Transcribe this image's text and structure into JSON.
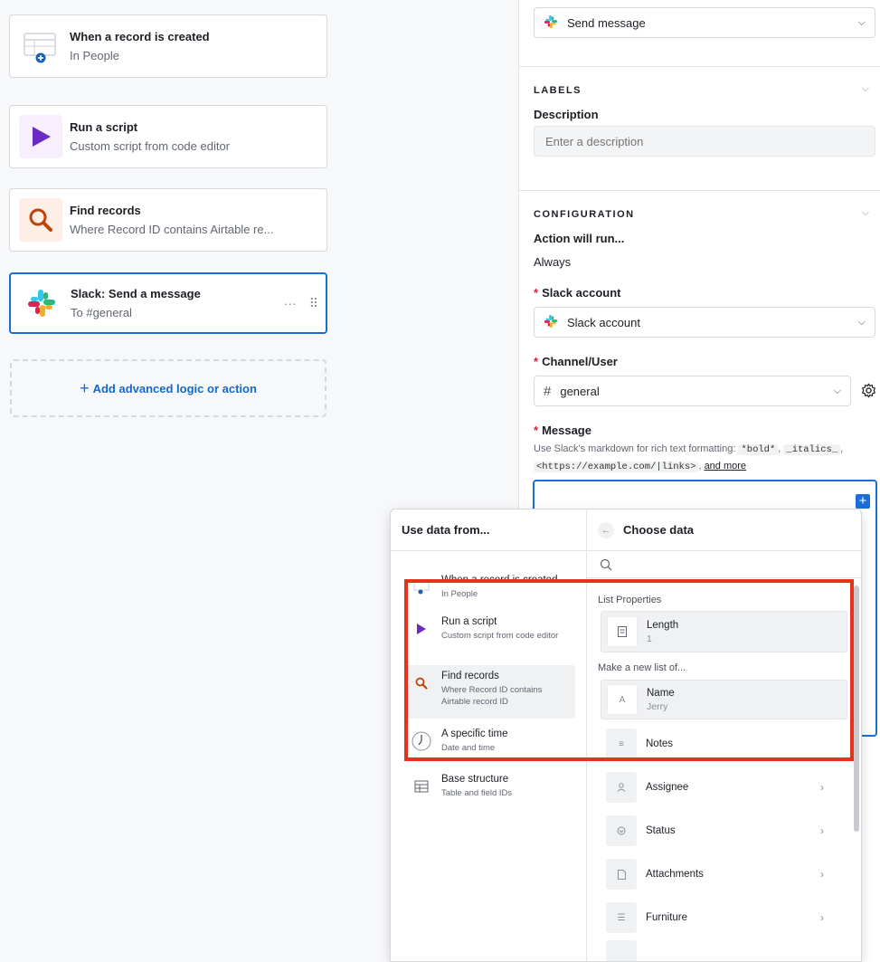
{
  "steps": [
    {
      "title": "When a record is created",
      "sub": "In People"
    },
    {
      "title": "Run a script",
      "sub": "Custom script from code editor"
    },
    {
      "title": "Find records",
      "sub": "Where Record ID contains Airtable re..."
    },
    {
      "title": "Slack: Send a message",
      "sub": "To #general"
    }
  ],
  "add_logic_label": "Add advanced logic or action",
  "panel": {
    "action_select": "Send message",
    "labels_section": "LABELS",
    "description_label": "Description",
    "description_placeholder": "Enter a description",
    "configuration_section": "CONFIGURATION",
    "action_will_run_label": "Action will run...",
    "action_will_run_value": "Always",
    "slack_account_label": "Slack account",
    "slack_account_value": "Slack account",
    "channel_label": "Channel/User",
    "channel_value": "general",
    "message_label": "Message",
    "help_text_1": "Use Slack's markdown for rich text formatting:",
    "help_code_bold": "*bold*",
    "help_code_italics": "_italics_",
    "help_code_link": "<https://example.com/|links>",
    "help_and_more": "and more",
    "required_mark": "*"
  },
  "popover": {
    "left_title": "Use data from...",
    "right_title": "Choose data",
    "sources": [
      {
        "title": "When a record is created",
        "sub": "In People"
      },
      {
        "title": "Run a script",
        "sub": "Custom script from code editor"
      },
      {
        "title": "Find records",
        "sub": "Where Record ID contains Airtable record ID"
      },
      {
        "title": "A specific time",
        "sub": "Date and time"
      },
      {
        "title": "Base structure",
        "sub": "Table and field IDs"
      }
    ],
    "list_properties_label": "List Properties",
    "make_new_list_label": "Make a new list of...",
    "fields": [
      {
        "title": "Length",
        "sub": "1"
      },
      {
        "title": "Name",
        "sub": "Jerry"
      },
      {
        "title": "Notes",
        "sub": ""
      },
      {
        "title": "Assignee",
        "sub": ""
      },
      {
        "title": "Status",
        "sub": ""
      },
      {
        "title": "Attachments",
        "sub": ""
      },
      {
        "title": "Furniture",
        "sub": ""
      }
    ]
  },
  "colors": {
    "accent": "#1a6ed8",
    "highlight": "#e8311b",
    "script_purple": "#6b2bc4",
    "find_orange": "#c0420b"
  }
}
